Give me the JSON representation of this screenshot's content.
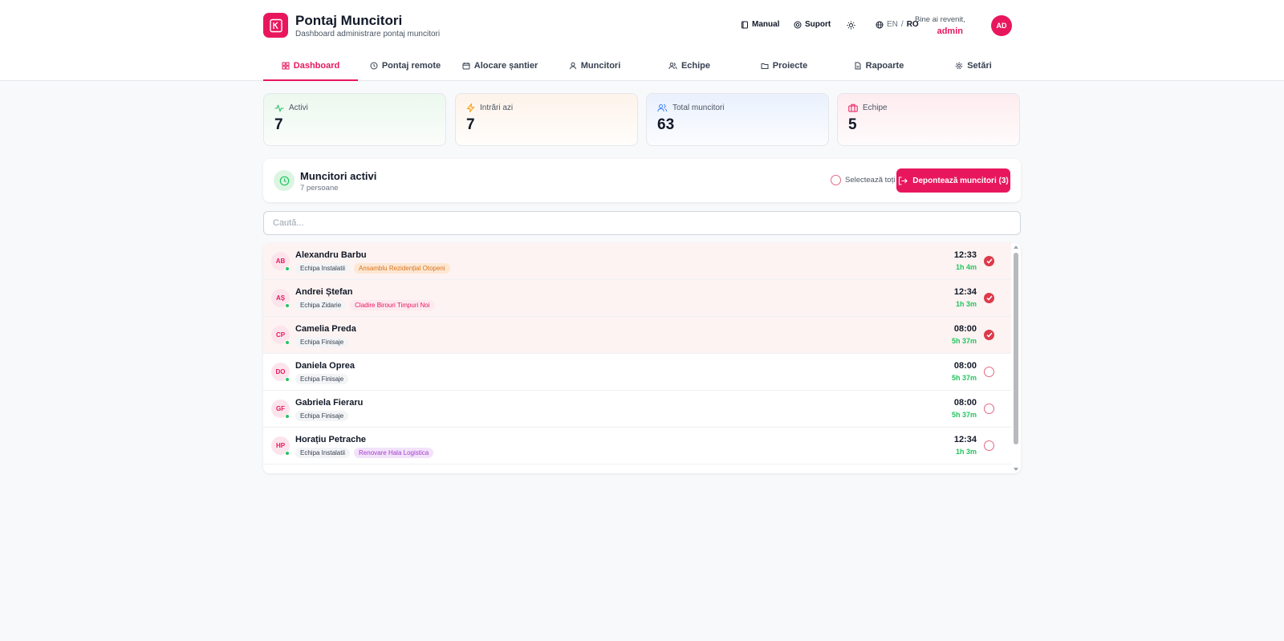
{
  "app": {
    "title": "Pontaj Muncitori",
    "subtitle": "Dashboard administrare pontaj muncitori"
  },
  "header": {
    "manual": "Manual",
    "support": "Suport",
    "lang_en": "EN",
    "lang_sep": "/",
    "lang_ro": "RO",
    "welcome": "Bine ai revenit,",
    "user": "admin",
    "user_initials": "AD"
  },
  "nav": {
    "tabs": [
      {
        "label": "Dashboard",
        "icon": "grid-icon",
        "active": true
      },
      {
        "label": "Pontaj remote",
        "icon": "clock-icon"
      },
      {
        "label": "Alocare șantier",
        "icon": "calendar-icon"
      },
      {
        "label": "Muncitori",
        "icon": "user-icon"
      },
      {
        "label": "Echipe",
        "icon": "users-icon"
      },
      {
        "label": "Proiecte",
        "icon": "folder-icon"
      },
      {
        "label": "Rapoarte",
        "icon": "file-icon"
      },
      {
        "label": "Setări",
        "icon": "gear-icon"
      }
    ]
  },
  "stats": [
    {
      "label": "Activi",
      "value": "7",
      "icon": "activity-icon",
      "color": "#22c55e"
    },
    {
      "label": "Intrări azi",
      "value": "7",
      "icon": "lightning-icon",
      "color": "#f59e0b"
    },
    {
      "label": "Total muncitori",
      "value": "63",
      "icon": "users-icon",
      "color": "#3b82f6"
    },
    {
      "label": "Echipe",
      "value": "5",
      "icon": "briefcase-icon",
      "color": "#e8175d"
    }
  ],
  "active_panel": {
    "title": "Muncitori activi",
    "count_text": "7 persoane",
    "select_all": "Selectează toți",
    "checkout_button": "Depontează muncitori (3)"
  },
  "search": {
    "placeholder": "Caută..."
  },
  "workers": [
    {
      "initials": "AB",
      "name": "Alexandru Barbu",
      "team": "Echipa Instalatii",
      "project": "Ansamblu Rezidențial Otopeni",
      "project_style": "orange",
      "time": "12:33",
      "duration": "1h 4m",
      "selected": true
    },
    {
      "initials": "AȘ",
      "name": "Andrei Ștefan",
      "team": "Echipa Zidarie",
      "project": "Cladire Birouri Timpuri Noi",
      "project_style": "pink",
      "time": "12:34",
      "duration": "1h 3m",
      "selected": true
    },
    {
      "initials": "CP",
      "name": "Camelia Preda",
      "team": "Echipa Finisaje",
      "project": "",
      "project_style": "",
      "time": "08:00",
      "duration": "5h 37m",
      "selected": true
    },
    {
      "initials": "DO",
      "name": "Daniela Oprea",
      "team": "Echipa Finisaje",
      "project": "",
      "project_style": "",
      "time": "08:00",
      "duration": "5h 37m",
      "selected": false
    },
    {
      "initials": "GF",
      "name": "Gabriela Fieraru",
      "team": "Echipa Finisaje",
      "project": "",
      "project_style": "",
      "time": "08:00",
      "duration": "5h 37m",
      "selected": false
    },
    {
      "initials": "HP",
      "name": "Horațiu Petrache",
      "team": "Echipa Instalatii",
      "project": "Renovare Hala Logistica",
      "project_style": "purple",
      "time": "12:34",
      "duration": "1h 3m",
      "selected": false
    }
  ],
  "colors": {
    "accent": "#e8175d",
    "success": "#22c55e",
    "checked": "#dc3a4a"
  }
}
